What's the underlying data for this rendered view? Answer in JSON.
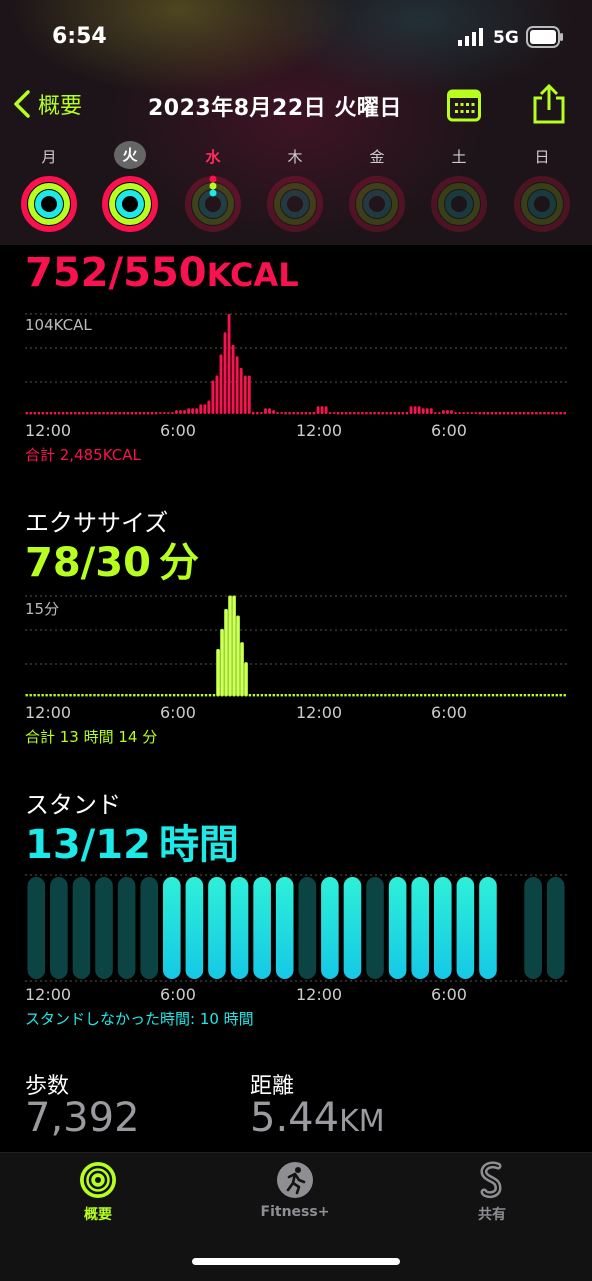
{
  "status": {
    "time": "6:54",
    "network": "5G"
  },
  "nav": {
    "back_label": "概要",
    "title": "2023年8月22日 火曜日"
  },
  "week": [
    {
      "label": "月",
      "state": "done"
    },
    {
      "label": "火",
      "state": "selected"
    },
    {
      "label": "水",
      "state": "today"
    },
    {
      "label": "木",
      "state": "future"
    },
    {
      "label": "金",
      "state": "future"
    },
    {
      "label": "土",
      "state": "future"
    },
    {
      "label": "日",
      "state": "future"
    }
  ],
  "colors": {
    "move": "#fa114f",
    "exercise": "#b6ff1e",
    "stand": "#1ee9e9"
  },
  "move": {
    "value": "752/550",
    "unit": "KCAL",
    "max_label": "104KCAL",
    "total": "合計 2,485KCAL",
    "chart_data": {
      "type": "bar",
      "title": "",
      "ylim": [
        0,
        104
      ],
      "x_ticks": [
        "12:00",
        "6:00",
        "12:00",
        "6:00"
      ],
      "values": [
        1,
        1,
        1,
        1,
        1,
        1,
        1,
        1,
        1,
        1,
        1,
        1,
        1,
        1,
        1,
        1,
        1,
        1,
        1,
        1,
        1,
        1,
        1,
        1,
        1,
        1,
        1,
        1,
        1,
        1,
        1,
        1,
        1,
        2,
        2,
        2,
        2,
        4,
        4,
        4,
        6,
        6,
        6,
        10,
        10,
        14,
        35,
        40,
        62,
        85,
        104,
        72,
        60,
        48,
        40,
        40,
        1,
        1,
        2,
        6,
        6,
        4,
        2,
        2,
        1,
        1,
        1,
        1,
        1,
        1,
        1,
        1,
        8,
        8,
        8,
        2,
        2,
        1,
        1,
        1,
        1,
        1,
        1,
        1,
        1,
        1,
        1,
        1,
        1,
        1,
        1,
        1,
        1,
        1,
        1,
        8,
        8,
        8,
        6,
        6,
        6,
        2,
        2,
        4,
        4,
        4,
        2,
        2,
        2,
        2,
        2,
        2,
        1,
        1,
        1,
        1,
        1,
        1,
        1,
        1,
        1,
        1,
        1,
        1,
        1,
        1,
        1,
        1,
        1,
        1,
        1,
        1,
        1,
        1
      ]
    }
  },
  "exercise": {
    "title": "エクササイズ",
    "value": "78/30",
    "unit": "分",
    "max_label": "15分",
    "total": "合計 13 時間 14 分",
    "chart_data": {
      "type": "bar",
      "ylim": [
        0,
        15
      ],
      "x_ticks": [
        "12:00",
        "6:00",
        "12:00",
        "6:00"
      ],
      "values": [
        0,
        0,
        0,
        0,
        0,
        0,
        0,
        0,
        0,
        0,
        0,
        0,
        0,
        0,
        0,
        0,
        0,
        0,
        0,
        0,
        0,
        0,
        0,
        0,
        0,
        0,
        0,
        0,
        0,
        0,
        0,
        0,
        0,
        0,
        0,
        0,
        0,
        0,
        0,
        0,
        0,
        0,
        0,
        0,
        0,
        0,
        0,
        0,
        7,
        10,
        13,
        15,
        15,
        12,
        8,
        5,
        0,
        0,
        0,
        0,
        0,
        0,
        0,
        0,
        0,
        0,
        0,
        0,
        0,
        0,
        0,
        0,
        0,
        0,
        0,
        0,
        0,
        0,
        0,
        0,
        0,
        0,
        0,
        0,
        0,
        0,
        0,
        0,
        0,
        0,
        0,
        0,
        0,
        0,
        0,
        0,
        0,
        0,
        0,
        0,
        0,
        0,
        0,
        0,
        0,
        0,
        0,
        0,
        0,
        0,
        0,
        0,
        0,
        0,
        0,
        0,
        0,
        0,
        0,
        0,
        0,
        0,
        0,
        0,
        0,
        0,
        0,
        0,
        0,
        0,
        0,
        0,
        0,
        0,
        0,
        0
      ]
    }
  },
  "stand": {
    "title": "スタンド",
    "value": "13/12",
    "unit": "時間",
    "not_stood": "スタンドしなかった時間: 10 時間",
    "chart_data": {
      "type": "bar",
      "x_ticks": [
        "12:00",
        "6:00",
        "12:00",
        "6:00"
      ],
      "hours": [
        0,
        0,
        0,
        0,
        0,
        0,
        1,
        1,
        1,
        1,
        1,
        1,
        0,
        1,
        1,
        0,
        1,
        1,
        1,
        1,
        1,
        null,
        0,
        0
      ]
    }
  },
  "steps": {
    "label": "歩数",
    "value": "7,392"
  },
  "distance": {
    "label": "距離",
    "value": "5.44",
    "unit": "KM"
  },
  "tabs": [
    {
      "label": "概要",
      "active": true
    },
    {
      "label": "Fitness+",
      "active": false
    },
    {
      "label": "共有",
      "active": false
    }
  ]
}
